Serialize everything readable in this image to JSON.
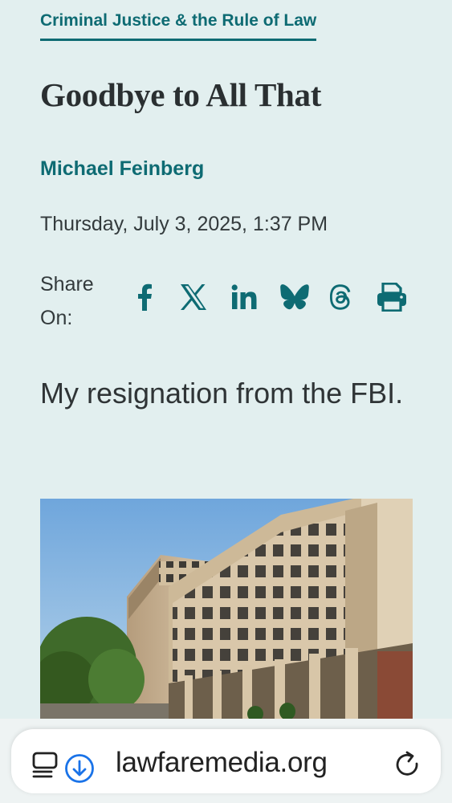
{
  "article": {
    "category": "Criminal Justice & the Rule of Law",
    "title": "Goodbye to All That",
    "author": "Michael Feinberg",
    "date": "Thursday, July 3, 2025, 1:37 PM",
    "share_label": "Share On:",
    "dek": "My resignation from the FBI."
  },
  "share_icons": [
    "facebook-icon",
    "x-icon",
    "linkedin-icon",
    "bluesky-icon",
    "threads-icon",
    "print-icon"
  ],
  "browser": {
    "url": "lawfaremedia.org"
  },
  "colors": {
    "background": "#e2efef",
    "accent": "#0e6b73",
    "text": "#2f3436",
    "download_accent": "#1a73e8"
  }
}
